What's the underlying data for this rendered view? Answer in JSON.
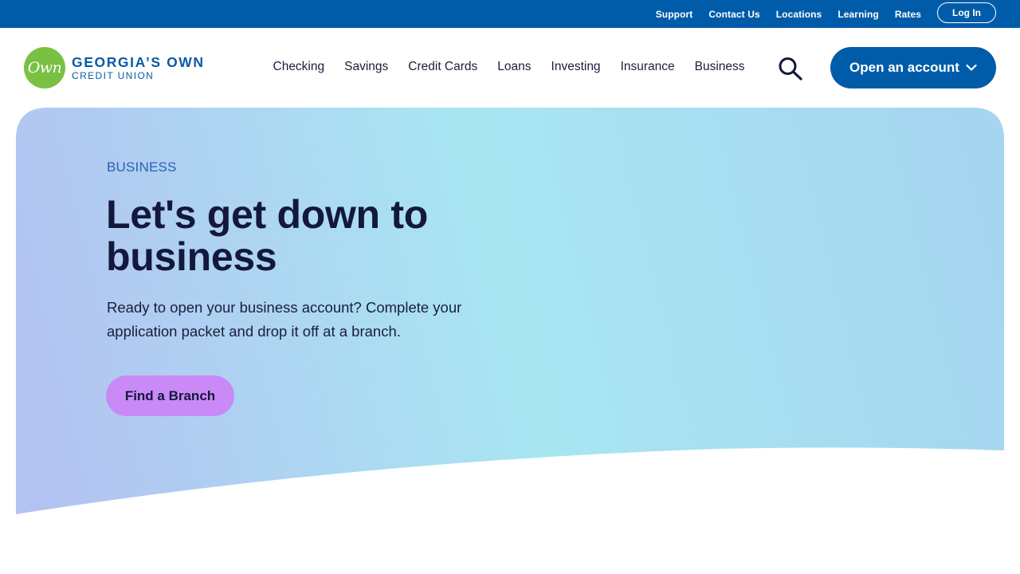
{
  "utility_nav": {
    "links": [
      "Support",
      "Contact Us",
      "Locations",
      "Learning",
      "Rates"
    ],
    "login_label": "Log In"
  },
  "logo": {
    "mark": "Own",
    "line1": "GEORGIA’S OWN",
    "line2": "CREDIT UNION"
  },
  "main_nav": {
    "items": [
      "Checking",
      "Savings",
      "Credit Cards",
      "Loans",
      "Investing",
      "Insurance",
      "Business"
    ],
    "search_icon": "search-icon",
    "open_account_label": "Open an account",
    "open_account_icon": "chevron-down-icon"
  },
  "hero": {
    "eyebrow": "BUSINESS",
    "title": "Let's get down to business",
    "body": "Ready to open your business account? Complete your application packet and drop it off at a branch.",
    "cta_label": "Find a Branch"
  },
  "colors": {
    "brand_blue": "#005ca8",
    "logo_green": "#7ac143",
    "cta_purple": "#c989f6",
    "heading_navy": "#13183c",
    "eyebrow_blue": "#2b5fb8",
    "hero_gradient": [
      "#b3c3f1",
      "#a8e6f2",
      "#a6d5f0"
    ]
  }
}
